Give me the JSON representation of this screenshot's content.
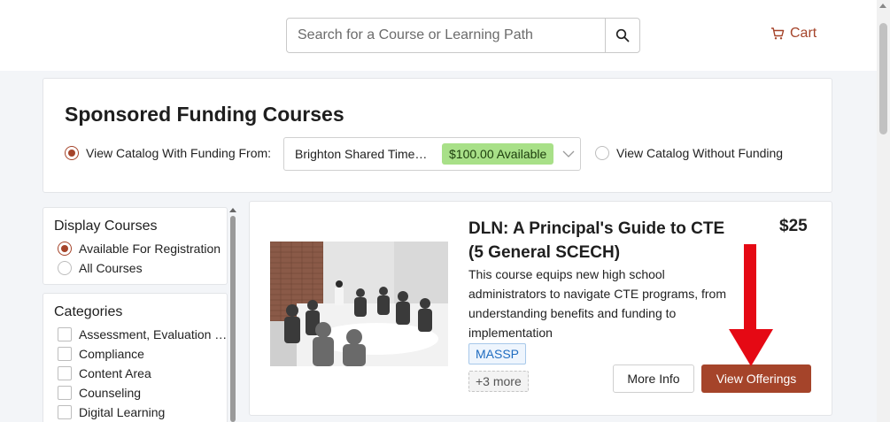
{
  "header": {
    "search_placeholder": "Search for a Course or Learning Path",
    "cart_label": "Cart",
    "accent_color": "#a5442a"
  },
  "funding": {
    "title": "Sponsored Funding Courses",
    "option_with_funding": "View Catalog With Funding From:",
    "selected_funder": "Brighton Shared Time…",
    "available_badge": "$100.00 Available",
    "option_without_funding": "View Catalog Without Funding",
    "selected_option": "with_funding"
  },
  "sidebar": {
    "display_title": "Display Courses",
    "display_options": [
      {
        "label": "Available For Registration",
        "selected": true
      },
      {
        "label": "All Courses",
        "selected": false
      }
    ],
    "categories_title": "Categories",
    "categories": [
      {
        "label": "Assessment, Evaluation …",
        "checked": false
      },
      {
        "label": "Compliance",
        "checked": false
      },
      {
        "label": "Content Area",
        "checked": false
      },
      {
        "label": "Counseling",
        "checked": false
      },
      {
        "label": "Digital Learning",
        "checked": false
      }
    ]
  },
  "course": {
    "title": "DLN: A Principal's Guide to CTE (5 General SCECH)",
    "price": "$25",
    "description": "This course equips new high school administrators to navigate CTE programs, from understanding benefits and funding to implementation",
    "tag": "MASSP",
    "more_tags": "+3 more",
    "more_info_label": "More Info",
    "view_offerings_label": "View Offerings"
  },
  "annotation": {
    "arrow_color": "#e50914",
    "points_to": "View Offerings"
  }
}
